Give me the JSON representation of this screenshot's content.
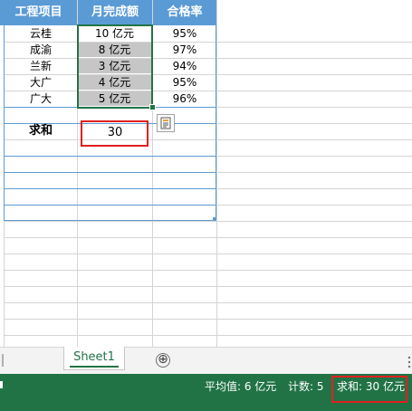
{
  "headers": [
    "工程项目",
    "月完成额",
    "合格率"
  ],
  "rows": [
    {
      "project": "云桂",
      "amount": "10 亿元",
      "rate": "95%"
    },
    {
      "project": "成渝",
      "amount": "8 亿元",
      "rate": "97%"
    },
    {
      "project": "兰新",
      "amount": "3 亿元",
      "rate": "94%"
    },
    {
      "project": "大广",
      "amount": "4 亿元",
      "rate": "95%"
    },
    {
      "project": "广大",
      "amount": "5 亿元",
      "rate": "96%"
    }
  ],
  "sum": {
    "label": "求和",
    "value": "30"
  },
  "tabs": {
    "sheet1": "Sheet1",
    "add": "⊕"
  },
  "status": {
    "average": "平均值: 6 亿元",
    "count": "计数: 5",
    "sum": "求和: 30 亿元"
  },
  "colors": {
    "header": "#5b9bd5",
    "selection": "#217346",
    "highlight": "#e02020",
    "status_bar": "#217346"
  },
  "icons": {
    "quick_analysis": "quick-analysis-icon",
    "add_sheet": "plus-circle-icon"
  }
}
